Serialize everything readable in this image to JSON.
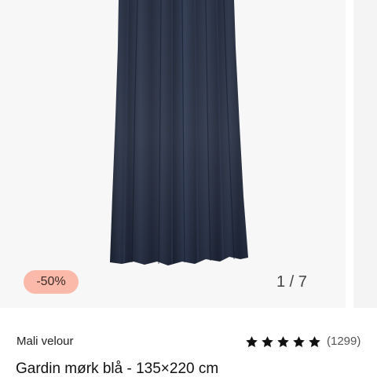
{
  "gallery": {
    "discount_badge": "-50%",
    "image_counter": "1 / 7",
    "product_image_alt": "Gardin mørk blå"
  },
  "product": {
    "brand": "Mali velour",
    "title": "Gardin mørk blå - 135×220 cm",
    "rating_stars": 5,
    "review_count": "(1299)"
  },
  "colors": {
    "badge_background": "#fbb9a9",
    "curtain": "#1f2738",
    "image_background": "#f7f7f7"
  }
}
